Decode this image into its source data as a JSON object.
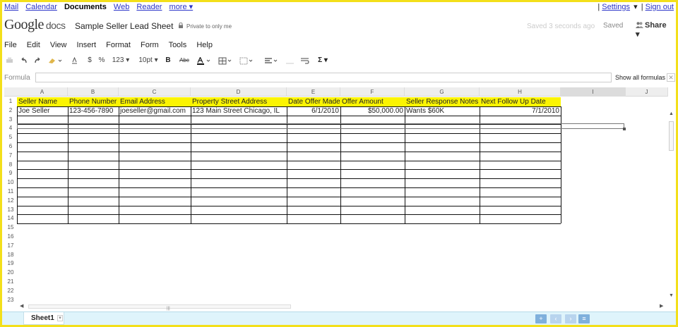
{
  "topnav": {
    "links": [
      "Mail",
      "Calendar",
      "Documents",
      "Web",
      "Reader",
      "more ▾"
    ],
    "right_links": [
      "Settings",
      "▾",
      "Sign out"
    ],
    "separators": [
      "|",
      "|"
    ]
  },
  "title": {
    "logo": "Google",
    "logo_docs": "docs",
    "doc_title": "Sample Seller Lead Sheet",
    "privacy": "Private to only me",
    "autosave": "Saved 3 seconds ago",
    "saved_label": "Saved",
    "share_label": "Share ▾"
  },
  "menu": [
    "File",
    "Edit",
    "View",
    "Insert",
    "Format",
    "Form",
    "Tools",
    "Help"
  ],
  "toolbar": {
    "currency": "$",
    "percent": "%",
    "number_format": "123 ▾",
    "font_size": "10pt ▾",
    "bold": "B",
    "strike": "Abc",
    "sigma": "Σ ▾"
  },
  "formula": {
    "label": "Formula",
    "value": "",
    "show_formulas": "Show all formulas",
    "close": "✕"
  },
  "grid": {
    "columns": [
      "A",
      "B",
      "C",
      "D",
      "E",
      "F",
      "G",
      "H",
      "I",
      "J"
    ],
    "rows": [
      "1",
      "2",
      "3",
      "4",
      "5",
      "6",
      "7",
      "8",
      "9",
      "10",
      "11",
      "12",
      "13",
      "14",
      "15",
      "16",
      "17",
      "18",
      "19",
      "20",
      "21",
      "22",
      "23"
    ],
    "header_cells": [
      "Seller Name",
      "Phone Number",
      "Email Address",
      "Property Street Address",
      "Date Offer Made",
      "Offer Amount",
      "Seller Response Notes",
      "Next Follow Up Date"
    ],
    "data_row": [
      "Joe Seller",
      "123-456-7890",
      "joeseller@gmail.com",
      "123 Main Street Chicago, IL",
      "6/1/2010",
      "$50,000.00",
      "Wants $60K",
      "7/1/2010"
    ]
  },
  "sheets": {
    "tab_label": "Sheet1",
    "tab_dropdown": "▾",
    "add_button": "+",
    "prev_button": "‹",
    "next_button": "›",
    "list_button": "≡"
  },
  "colors": {
    "frame": "#f3df1a",
    "header_fill": "#fbf402",
    "link": "#2a33c8",
    "tabbar": "#dff4fb"
  }
}
